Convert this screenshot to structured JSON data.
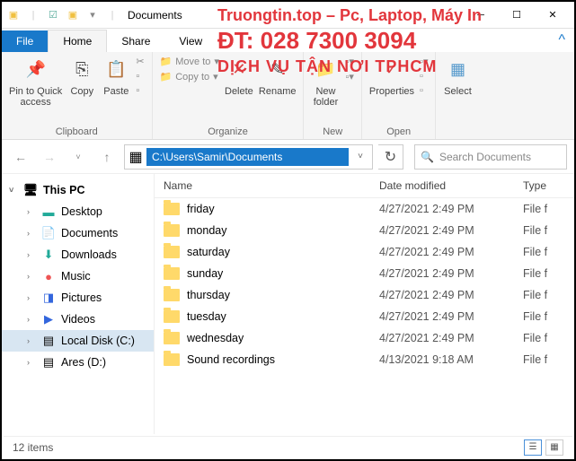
{
  "window": {
    "title": "Documents"
  },
  "tabs": {
    "file": "File",
    "home": "Home",
    "share": "Share",
    "view": "View"
  },
  "ribbon": {
    "pin": "Pin to Quick\naccess",
    "copy": "Copy",
    "paste": "Paste",
    "moveto": "Move to",
    "copyto": "Copy to",
    "delete": "Delete",
    "rename": "Rename",
    "newfolder": "New\nfolder",
    "properties": "Properties",
    "select": "Select",
    "grp_clipboard": "Clipboard",
    "grp_organize": "Organize",
    "grp_new": "New",
    "grp_open": "Open"
  },
  "address": {
    "path": "C:\\Users\\Samir\\Documents"
  },
  "search": {
    "placeholder": "Search Documents"
  },
  "tree": {
    "thispc": "This PC",
    "desktop": "Desktop",
    "documents": "Documents",
    "downloads": "Downloads",
    "music": "Music",
    "pictures": "Pictures",
    "videos": "Videos",
    "localdisk": "Local Disk (C:)",
    "ares": "Ares (D:)"
  },
  "columns": {
    "name": "Name",
    "date": "Date modified",
    "type": "Type"
  },
  "files": [
    {
      "name": "friday",
      "date": "4/27/2021 2:49 PM",
      "type": "File f"
    },
    {
      "name": "monday",
      "date": "4/27/2021 2:49 PM",
      "type": "File f"
    },
    {
      "name": "saturday",
      "date": "4/27/2021 2:49 PM",
      "type": "File f"
    },
    {
      "name": "sunday",
      "date": "4/27/2021 2:49 PM",
      "type": "File f"
    },
    {
      "name": "thursday",
      "date": "4/27/2021 2:49 PM",
      "type": "File f"
    },
    {
      "name": "tuesday",
      "date": "4/27/2021 2:49 PM",
      "type": "File f"
    },
    {
      "name": "wednesday",
      "date": "4/27/2021 2:49 PM",
      "type": "File f"
    },
    {
      "name": "Sound recordings",
      "date": "4/13/2021 9:18 AM",
      "type": "File f"
    }
  ],
  "status": {
    "count": "12 items"
  },
  "watermark": {
    "l1": "Truongtin.top – Pc, Laptop, Máy In",
    "l2": "ĐT: 028 7300 3094",
    "l3": "DỊCH VỤ TẬN NƠI TPHCM"
  }
}
